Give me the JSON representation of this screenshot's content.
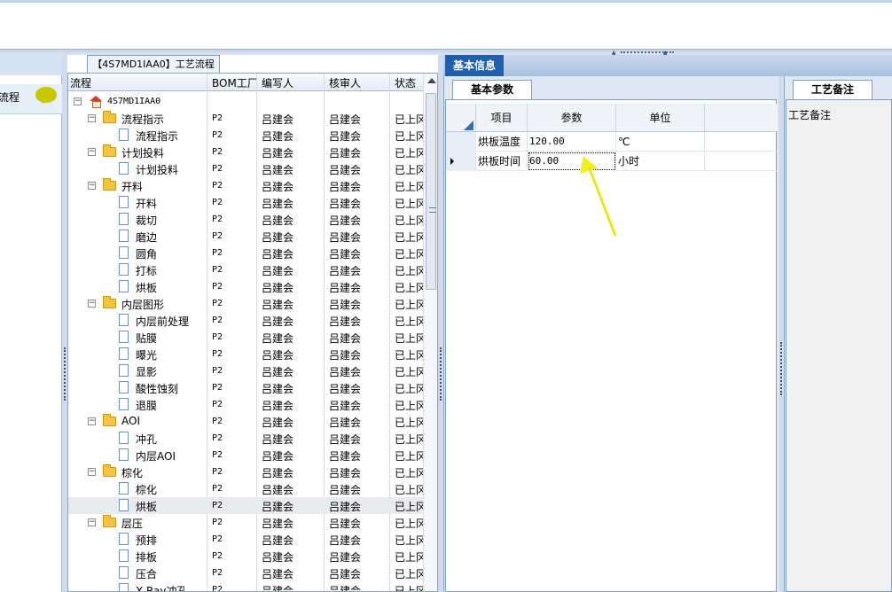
{
  "left": {
    "item_label": "流程"
  },
  "tree": {
    "tab_title": "【4S7MD1IAA0】工艺流程",
    "headers": {
      "name": "流程",
      "bom": "BOM工厂",
      "writer": "编写人",
      "reviewer": "核审人",
      "status": "状态"
    },
    "root": "4S7MD1IAA0",
    "rows": [
      {
        "kind": "folder",
        "level": 1,
        "name": "流程指示",
        "bom": "P2",
        "writer": "吕建会",
        "reviewer": "吕建会",
        "status": "已上冈"
      },
      {
        "kind": "doc",
        "level": 2,
        "name": "流程指示",
        "bom": "P2",
        "writer": "吕建会",
        "reviewer": "吕建会",
        "status": "已上冈"
      },
      {
        "kind": "folder",
        "level": 1,
        "name": "计划投料",
        "bom": "P2",
        "writer": "吕建会",
        "reviewer": "吕建会",
        "status": "已上冈"
      },
      {
        "kind": "doc",
        "level": 2,
        "name": "计划投料",
        "bom": "P2",
        "writer": "吕建会",
        "reviewer": "吕建会",
        "status": "已上冈"
      },
      {
        "kind": "folder",
        "level": 1,
        "name": "开料",
        "bom": "P2",
        "writer": "吕建会",
        "reviewer": "吕建会",
        "status": "已上冈"
      },
      {
        "kind": "doc",
        "level": 2,
        "name": "开料",
        "bom": "P2",
        "writer": "吕建会",
        "reviewer": "吕建会",
        "status": "已上冈"
      },
      {
        "kind": "doc",
        "level": 2,
        "name": "裁切",
        "bom": "P2",
        "writer": "吕建会",
        "reviewer": "吕建会",
        "status": "已上冈"
      },
      {
        "kind": "doc",
        "level": 2,
        "name": "磨边",
        "bom": "P2",
        "writer": "吕建会",
        "reviewer": "吕建会",
        "status": "已上冈"
      },
      {
        "kind": "doc",
        "level": 2,
        "name": "圆角",
        "bom": "P2",
        "writer": "吕建会",
        "reviewer": "吕建会",
        "status": "已上冈"
      },
      {
        "kind": "doc",
        "level": 2,
        "name": "打标",
        "bom": "P2",
        "writer": "吕建会",
        "reviewer": "吕建会",
        "status": "已上冈"
      },
      {
        "kind": "doc",
        "level": 2,
        "name": "烘板",
        "bom": "P2",
        "writer": "吕建会",
        "reviewer": "吕建会",
        "status": "已上冈"
      },
      {
        "kind": "folder",
        "level": 1,
        "name": "内层图形",
        "bom": "P2",
        "writer": "吕建会",
        "reviewer": "吕建会",
        "status": "已上冈"
      },
      {
        "kind": "doc",
        "level": 2,
        "name": "内层前处理",
        "bom": "P2",
        "writer": "吕建会",
        "reviewer": "吕建会",
        "status": "已上冈"
      },
      {
        "kind": "doc",
        "level": 2,
        "name": "贴膜",
        "bom": "P2",
        "writer": "吕建会",
        "reviewer": "吕建会",
        "status": "已上冈"
      },
      {
        "kind": "doc",
        "level": 2,
        "name": "曝光",
        "bom": "P2",
        "writer": "吕建会",
        "reviewer": "吕建会",
        "status": "已上冈"
      },
      {
        "kind": "doc",
        "level": 2,
        "name": "显影",
        "bom": "P2",
        "writer": "吕建会",
        "reviewer": "吕建会",
        "status": "已上冈"
      },
      {
        "kind": "doc",
        "level": 2,
        "name": "酸性蚀刻",
        "bom": "P2",
        "writer": "吕建会",
        "reviewer": "吕建会",
        "status": "已上冈"
      },
      {
        "kind": "doc",
        "level": 2,
        "name": "退膜",
        "bom": "P2",
        "writer": "吕建会",
        "reviewer": "吕建会",
        "status": "已上冈"
      },
      {
        "kind": "folder",
        "level": 1,
        "name": "AOI",
        "bom": "P2",
        "writer": "吕建会",
        "reviewer": "吕建会",
        "status": "已上冈"
      },
      {
        "kind": "doc",
        "level": 2,
        "name": "冲孔",
        "bom": "P2",
        "writer": "吕建会",
        "reviewer": "吕建会",
        "status": "已上冈"
      },
      {
        "kind": "doc",
        "level": 2,
        "name": "内层AOI",
        "bom": "P2",
        "writer": "吕建会",
        "reviewer": "吕建会",
        "status": "已上冈"
      },
      {
        "kind": "folder",
        "level": 1,
        "name": "棕化",
        "bom": "P2",
        "writer": "吕建会",
        "reviewer": "吕建会",
        "status": "已上冈"
      },
      {
        "kind": "doc",
        "level": 2,
        "name": "棕化",
        "bom": "P2",
        "writer": "吕建会",
        "reviewer": "吕建会",
        "status": "已上冈"
      },
      {
        "kind": "doc",
        "level": 2,
        "name": "烘板",
        "bom": "P2",
        "writer": "吕建会",
        "reviewer": "吕建会",
        "status": "已上冈",
        "selected": true
      },
      {
        "kind": "folder",
        "level": 1,
        "name": "层压",
        "bom": "P2",
        "writer": "吕建会",
        "reviewer": "吕建会",
        "status": "已上冈"
      },
      {
        "kind": "doc",
        "level": 2,
        "name": "预排",
        "bom": "P2",
        "writer": "吕建会",
        "reviewer": "吕建会",
        "status": "已上冈"
      },
      {
        "kind": "doc",
        "level": 2,
        "name": "排板",
        "bom": "P2",
        "writer": "吕建会",
        "reviewer": "吕建会",
        "status": "已上冈"
      },
      {
        "kind": "doc",
        "level": 2,
        "name": "压合",
        "bom": "P2",
        "writer": "吕建会",
        "reviewer": "吕建会",
        "status": "已上冈"
      },
      {
        "kind": "doc",
        "level": 2,
        "name": "X-Ray冲孔",
        "bom": "P2",
        "writer": "吕建会",
        "reviewer": "吕建会",
        "status": "已上冈"
      }
    ]
  },
  "info": {
    "tab": "基本信息",
    "sub_tab": "基本参数",
    "headers": {
      "item": "项目",
      "param": "参数",
      "unit": "单位"
    },
    "rows": [
      {
        "item": "烘板温度",
        "param": "120.00",
        "unit": "℃"
      },
      {
        "item": "烘板时间",
        "param": "60.00",
        "unit": "小时"
      }
    ]
  },
  "notes": {
    "tab": "工艺备注",
    "label": "工艺备注"
  },
  "colors": {
    "accent": "#1f5fae",
    "arrow": "#f0f020"
  }
}
